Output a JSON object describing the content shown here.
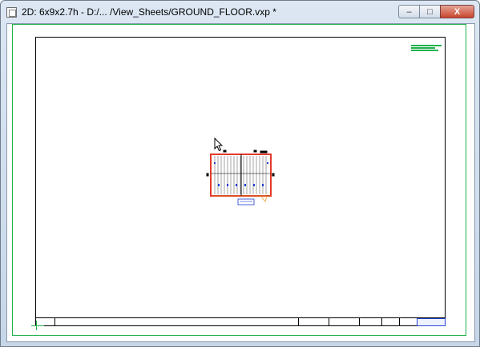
{
  "window": {
    "title": "2D: 6x9x2.7h - D:/... /View_Sheets/GROUND_FLOOR.vxp *",
    "buttons": {
      "minimize": "–",
      "maximize": "□",
      "close": "X"
    }
  },
  "canvas": {
    "view_sheet": "GROUND_FLOOR",
    "floor_plan_label": "6x9"
  },
  "colors": {
    "frame_green": "#22b14c",
    "plan_wall_red": "#e23a2a",
    "plan_blue": "#1f3bd1",
    "titleblock_blue": "#2244dd"
  }
}
